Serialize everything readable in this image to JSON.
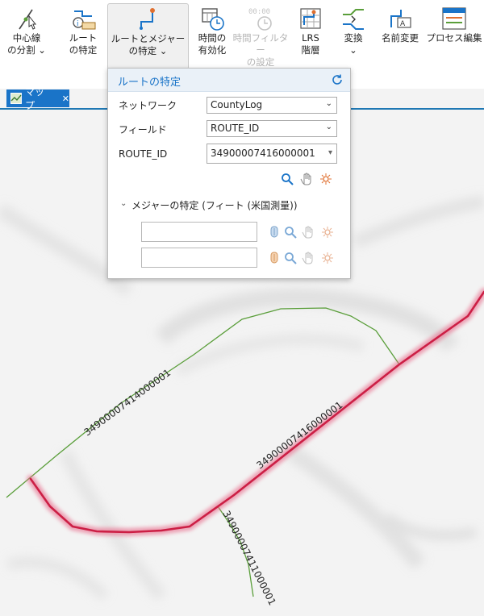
{
  "ribbon": {
    "split": {
      "line1": "中心線",
      "line2": "の分割 ⌄"
    },
    "identify": {
      "line1": "ルート",
      "line2": "の特定"
    },
    "route_measure": {
      "line1": "ルートとメジャー",
      "line2": "の特定 ⌄"
    },
    "time_enable": {
      "line1": "時間の",
      "line2": "有効化"
    },
    "time_filter": {
      "line1": "時間フィルター",
      "line2": "の設定"
    },
    "lrs": {
      "line1": "LRS",
      "line2": "階層"
    },
    "transform": {
      "line1": "変換",
      "line2": "⌄"
    },
    "rename": {
      "line1": "名前変更"
    },
    "process": {
      "line1": "プロセス編集"
    }
  },
  "tab": {
    "label": "マップ",
    "close": "✕"
  },
  "panel": {
    "title": "ルートの特定",
    "network_label": "ネットワーク",
    "network_value": "CountyLog",
    "field_label": "フィールド",
    "field_value": "ROUTE_ID",
    "route_id_label": "ROUTE_ID",
    "route_id_value": "34900007416000001",
    "measure_section": "メジャーの特定 (フィート (米国測量))",
    "measure_from": "",
    "measure_to": ""
  },
  "map": {
    "labels": {
      "route_a": "34900007414000001",
      "route_b": "34900007416000001",
      "route_c": "34900007411000001"
    }
  },
  "colors": {
    "accent": "#1a74c8",
    "highlight": "#e01a4f",
    "road": "#5a9e3a"
  }
}
